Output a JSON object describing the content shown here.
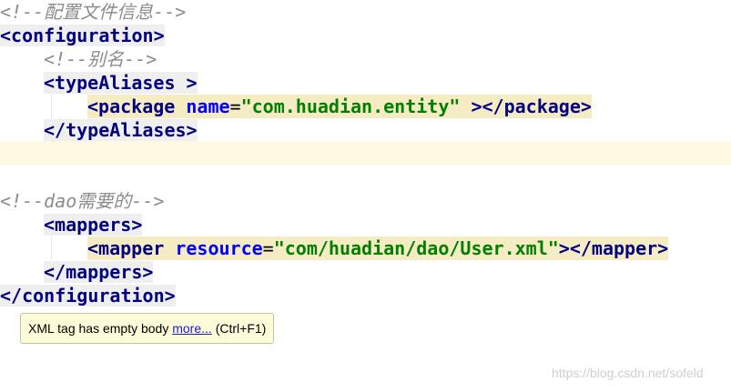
{
  "code": {
    "comment_config": "<!--配置文件信息-->",
    "configuration_open": "<configuration>",
    "comment_alias": "<!--别名-->",
    "typealiases_open": "<typeAliases >",
    "package_tag_open": "<package",
    "package_attr_name": "name",
    "equals": "=",
    "package_attr_value": "\"com.huadian.entity\"",
    "package_tag_close": " ></package>",
    "typealiases_close": "</typeAliases>",
    "comment_dao": "<!--dao需要的-->",
    "mappers_open": "<mappers>",
    "mapper_tag_open": "<mapper",
    "mapper_attr_name": "resource",
    "mapper_attr_value": "\"com/huadian/dao/User.xml\"",
    "mapper_tag_close": "></mapper>",
    "mappers_close": "</mappers>",
    "configuration_close": "</configuration>"
  },
  "tooltip": {
    "message": "XML tag has empty body ",
    "link": "more...",
    "shortcut": " (Ctrl+F1)"
  },
  "watermark": "https://blog.csdn.net/sofeld",
  "colors": {
    "tag": "#000080",
    "attribute": "#0000ff",
    "value": "#008000",
    "comment": "#8c8c8c",
    "current_line": "#fdf9e3",
    "tooltip_bg": "#fcfcd8"
  }
}
